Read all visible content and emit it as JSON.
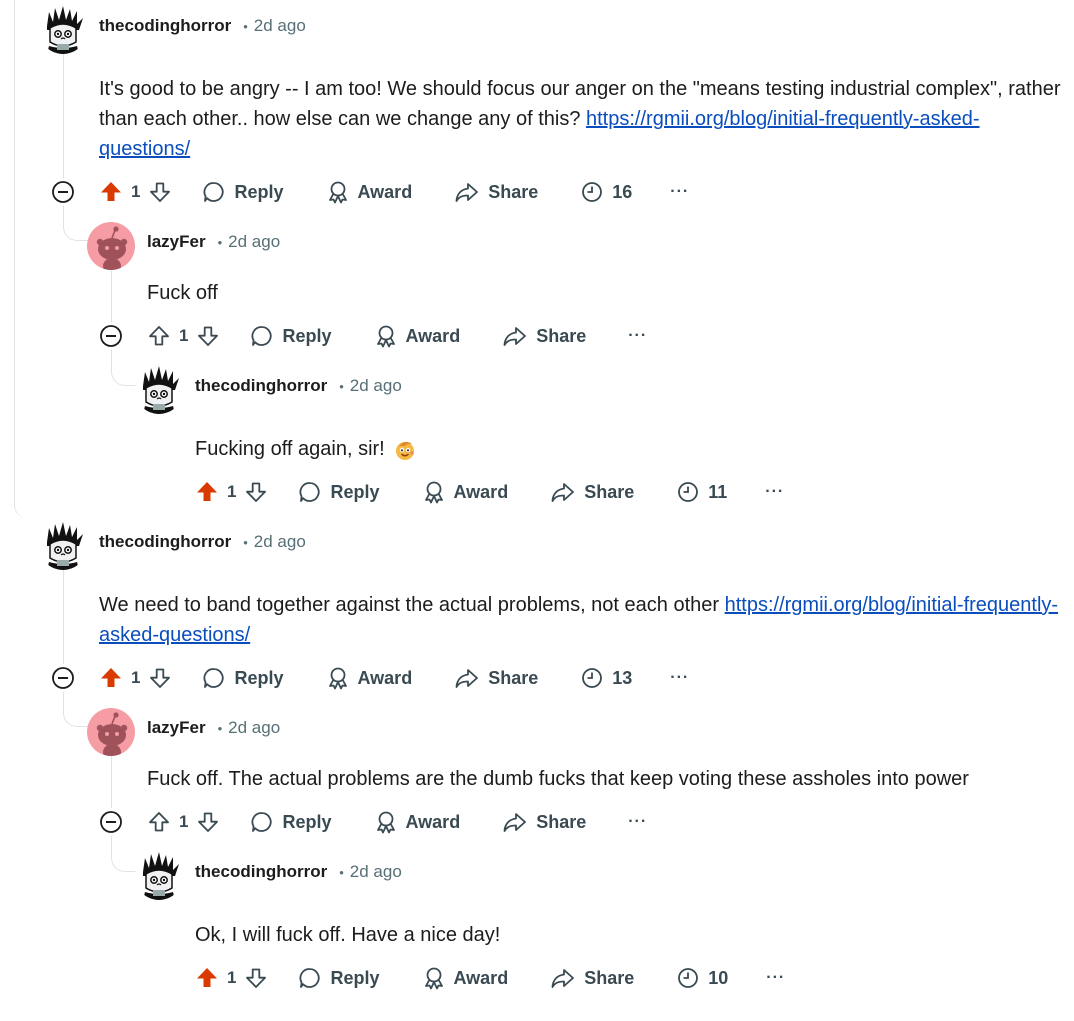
{
  "colors": {
    "upvoted": "#d93a00",
    "link": "#0a4ebd",
    "meta": "#576f76",
    "thread_line": "#dfe3e6"
  },
  "actions": {
    "reply": "Reply",
    "award": "Award",
    "share": "Share",
    "more": "···"
  },
  "icons": {
    "collapse": "minus-circle-icon",
    "upvote": "arrow-up-icon",
    "downvote": "arrow-down-icon",
    "reply": "speech-bubble-icon",
    "award": "award-ribbon-icon",
    "share": "share-arrow-icon",
    "timer": "clock-icon",
    "more": "ellipsis-icon"
  },
  "comments": [
    {
      "author": "thecodinghorror",
      "time": "2d ago",
      "text": "It's good to be angry -- I am too! We should focus our anger on the \"means testing industrial complex\", rather than each other.. how else can we change any of this? ",
      "link": "https://rgmii.org/blog/initial-frequently-asked-questions/",
      "votes": "1",
      "upvoted": true,
      "timer": "16"
    },
    {
      "author": "lazyFer",
      "time": "2d ago",
      "text": "Fuck off",
      "votes": "1",
      "upvoted": false
    },
    {
      "author": "thecodinghorror",
      "time": "2d ago",
      "text": "Fucking off again, sir!",
      "emoji": "smiling-face-emoji",
      "votes": "1",
      "upvoted": true,
      "timer": "11"
    },
    {
      "author": "thecodinghorror",
      "time": "2d ago",
      "text": "We need to band together against the actual problems, not each other ",
      "link": "https://rgmii.org/blog/initial-frequently-asked-questions/",
      "votes": "1",
      "upvoted": true,
      "timer": "13"
    },
    {
      "author": "lazyFer",
      "time": "2d ago",
      "text": "Fuck off. The actual problems are the dumb fucks that keep voting these assholes into power",
      "votes": "1",
      "upvoted": false
    },
    {
      "author": "thecodinghorror",
      "time": "2d ago",
      "text": "Ok, I will fuck off. Have a nice day!",
      "votes": "1",
      "upvoted": true,
      "timer": "10"
    }
  ]
}
